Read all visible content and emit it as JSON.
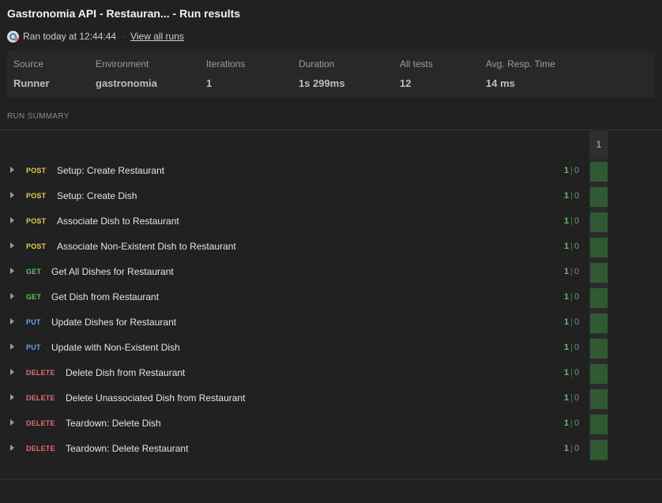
{
  "header": {
    "title": "Gastronomia API - Restauran... - Run results",
    "ran_text": "Ran today at 12:44:44",
    "separator": "·",
    "view_all_runs": "View all runs"
  },
  "stats": [
    {
      "label": "Source",
      "value": "Runner"
    },
    {
      "label": "Environment",
      "value": "gastronomia"
    },
    {
      "label": "Iterations",
      "value": "1"
    },
    {
      "label": "Duration",
      "value": "1s 299ms"
    },
    {
      "label": "All tests",
      "value": "12"
    },
    {
      "label": "Avg. Resp. Time",
      "value": "14 ms"
    }
  ],
  "summary": {
    "label": "RUN SUMMARY",
    "iteration_header": "1"
  },
  "colors": {
    "POST": "#e8c94f",
    "GET": "#5fc45f",
    "PUT": "#6a9fe8",
    "DELETE": "#e86b6b",
    "pass_cell": "#2f5a32"
  },
  "requests": [
    {
      "method": "POST",
      "name": "Setup: Create Restaurant",
      "passed": "1",
      "failed": "0"
    },
    {
      "method": "POST",
      "name": "Setup: Create Dish",
      "passed": "1",
      "failed": "0"
    },
    {
      "method": "POST",
      "name": "Associate Dish to Restaurant",
      "passed": "1",
      "failed": "0"
    },
    {
      "method": "POST",
      "name": "Associate Non-Existent Dish to Restaurant",
      "passed": "1",
      "failed": "0"
    },
    {
      "method": "GET",
      "name": "Get All Dishes for Restaurant",
      "passed": "1",
      "failed": "0"
    },
    {
      "method": "GET",
      "name": "Get Dish from Restaurant",
      "passed": "1",
      "failed": "0"
    },
    {
      "method": "PUT",
      "name": "Update Dishes for Restaurant",
      "passed": "1",
      "failed": "0"
    },
    {
      "method": "PUT",
      "name": "Update with Non-Existent Dish",
      "passed": "1",
      "failed": "0"
    },
    {
      "method": "DELETE",
      "name": "Delete Dish from Restaurant",
      "passed": "1",
      "failed": "0"
    },
    {
      "method": "DELETE",
      "name": "Delete Unassociated Dish from Restaurant",
      "passed": "1",
      "failed": "0"
    },
    {
      "method": "DELETE",
      "name": "Teardown: Delete Dish",
      "passed": "1",
      "failed": "0"
    },
    {
      "method": "DELETE",
      "name": "Teardown: Delete Restaurant",
      "passed": "1",
      "failed": "0"
    }
  ]
}
